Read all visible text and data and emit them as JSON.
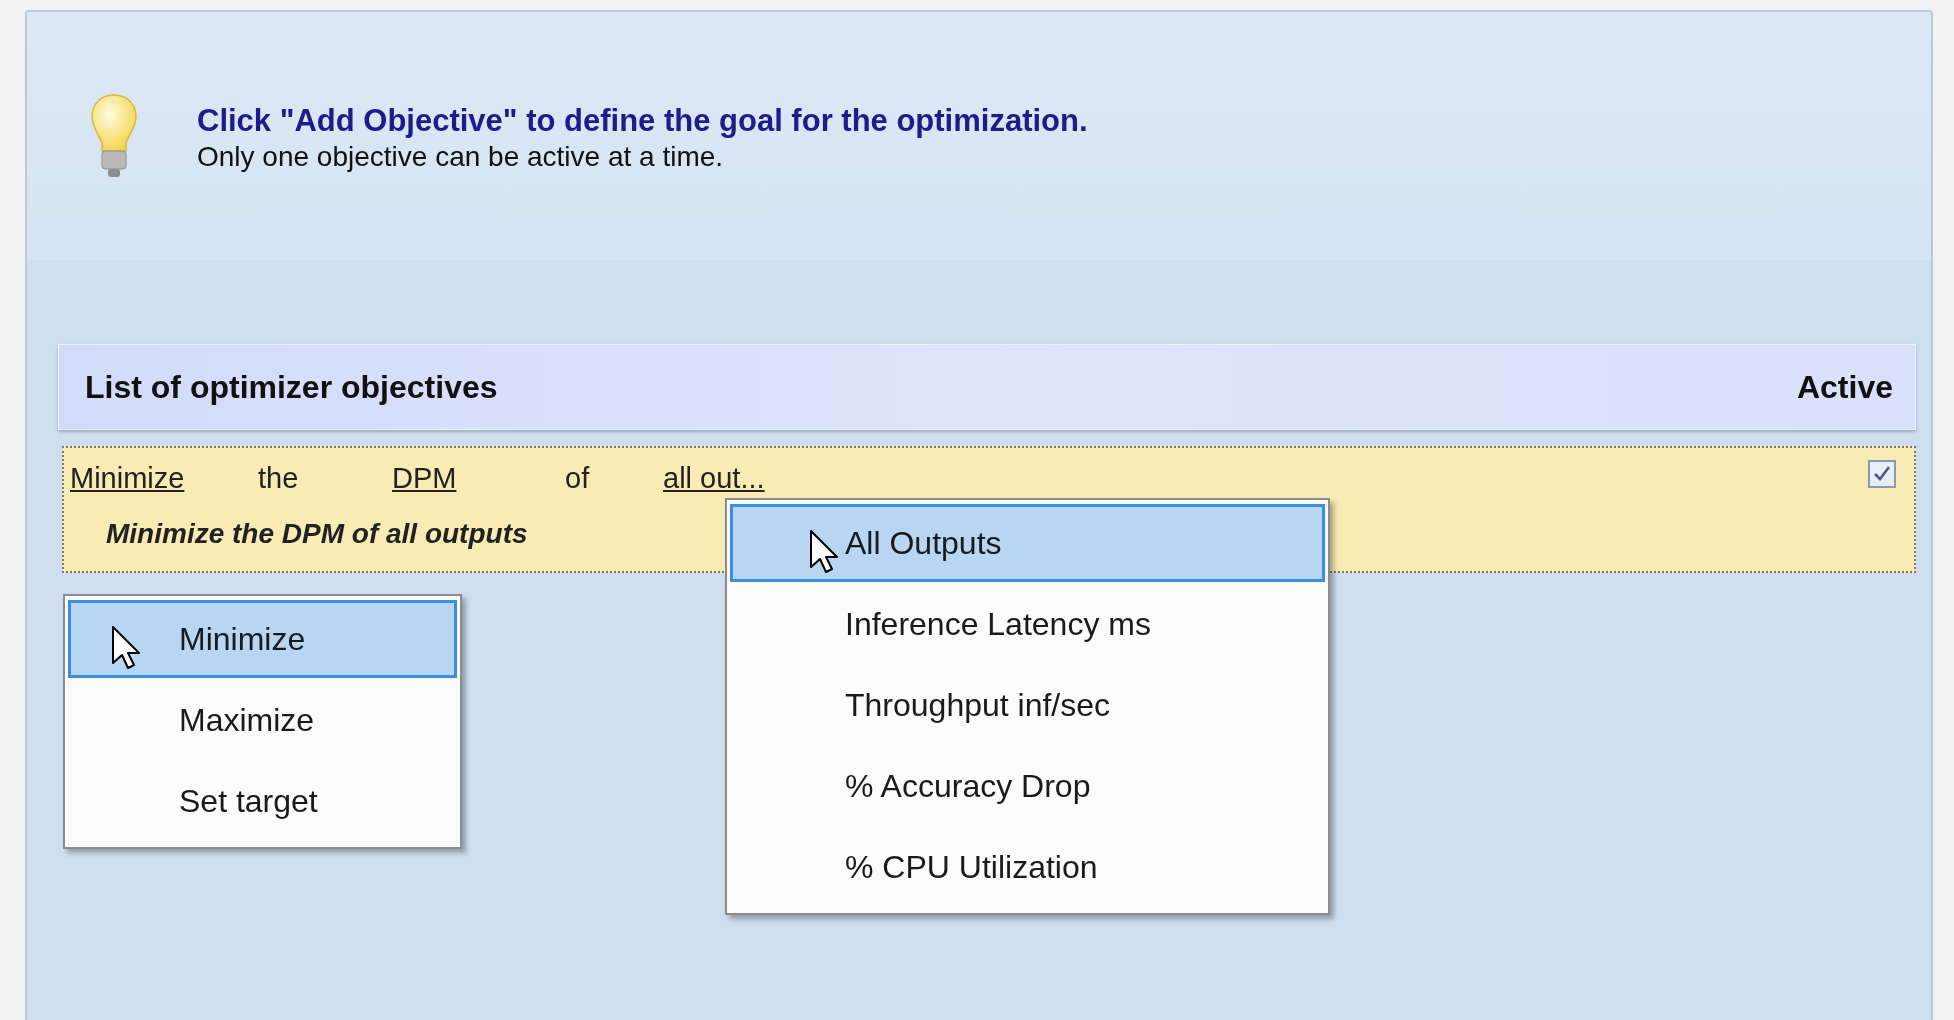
{
  "hint": {
    "title": "Click \"Add Objective\" to define the goal for the optimization.",
    "subtitle": "Only one objective can be active at a time."
  },
  "list": {
    "title": "List of optimizer objectives",
    "active_label": "Active",
    "rows": [
      {
        "tokens": [
          {
            "text": "Minimize",
            "kind": "link"
          },
          {
            "text": "the",
            "kind": "word"
          },
          {
            "text": "DPM",
            "kind": "link"
          },
          {
            "text": "of",
            "kind": "word"
          },
          {
            "text": "all out...",
            "kind": "link"
          }
        ],
        "summary": "Minimize the DPM of all outputs",
        "active": true
      }
    ]
  },
  "goal_menu": {
    "items": [
      {
        "label": "Minimize",
        "selected": true
      },
      {
        "label": "Maximize",
        "selected": false
      },
      {
        "label": "Set target",
        "selected": false
      }
    ]
  },
  "output_menu": {
    "items": [
      {
        "label": "All Outputs",
        "selected": true
      },
      {
        "label": "Inference Latency ms",
        "selected": false
      },
      {
        "label": "Throughput inf/sec",
        "selected": false
      },
      {
        "label": "% Accuracy Drop",
        "selected": false
      },
      {
        "label": "% CPU Utilization",
        "selected": false
      }
    ]
  }
}
